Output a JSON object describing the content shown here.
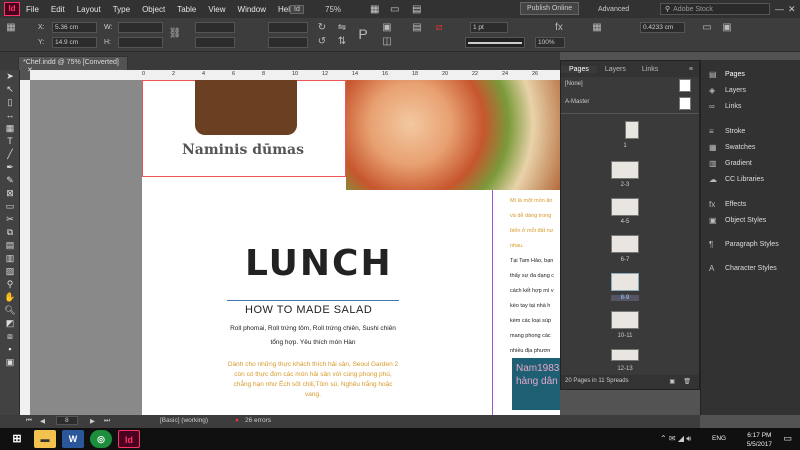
{
  "menu": {
    "logo": "Id",
    "items": [
      "File",
      "Edit",
      "Layout",
      "Type",
      "Object",
      "Table",
      "View",
      "Window",
      "Help"
    ],
    "zoom": "75%",
    "publish": "Publish Online",
    "workspace": "Advanced",
    "search_placeholder": "Adobe Stock"
  },
  "control": {
    "x_label": "X:",
    "x_val": "5.36 cm",
    "y_label": "Y:",
    "y_val": "14.9 cm",
    "w_label": "W:",
    "h_label": "H:",
    "stroke": "1 pt",
    "pct": "100%",
    "offset": "0.4233 cm"
  },
  "document": {
    "tab": "*Chef.indd @ 75% [Converted]"
  },
  "ruler_ticks": [
    "0",
    "2",
    "4",
    "6",
    "8",
    "10",
    "12",
    "14",
    "16",
    "18",
    "20",
    "22",
    "24",
    "26",
    "28",
    "30"
  ],
  "page": {
    "brand": "Naminis dūmas",
    "heading": "LUNCH",
    "subtitle": "HOW TO MADE SALAD",
    "body1": "Roll phomai, Roll trứng tôm, Roll trứng chiên, Sushi chiên tổng hợp. Yêu thích món Hàn",
    "body2": "Dành cho những thực khách thích hải sản, Seoul Garden 2 còn có thực đơn các món hải sản với cùng phong phú, chẳng hạn như Ếch sốt chili,Tôm sú, Nghêu trắng hoặc vang.",
    "column_lines": [
      "Mì là một món ăn",
      "và dễ dàng trong",
      "biến ở mỗi đất nư",
      "nhau.",
      "Tại Tam Hảo, bạn",
      "thấy sự đa dạng c",
      "cách kết hợp mì v",
      "kèo tay tại nhà h",
      "kèm các loại súp",
      "mang phong các",
      "nhiều địa phươn"
    ],
    "blue_text": "Nam1983 hàng dân"
  },
  "pages_panel": {
    "tabs": [
      "Pages",
      "Layers",
      "Links"
    ],
    "masters": [
      "[None]",
      "A-Master"
    ],
    "spreads": [
      "1",
      "2-3",
      "4-5",
      "6-7",
      "8-9",
      "10-11",
      "12-13"
    ],
    "footer": "20 Pages in 11 Spreads"
  },
  "dock": [
    {
      "icon": "▤",
      "label": "Pages"
    },
    {
      "icon": "◈",
      "label": "Layers"
    },
    {
      "icon": "∞",
      "label": "Links"
    },
    {
      "icon": "≡",
      "label": "Stroke"
    },
    {
      "icon": "▦",
      "label": "Swatches"
    },
    {
      "icon": "▥",
      "label": "Gradient"
    },
    {
      "icon": "☁",
      "label": "CC Libraries"
    },
    {
      "icon": "fx",
      "label": "Effects"
    },
    {
      "icon": "▣",
      "label": "Object Styles"
    },
    {
      "icon": "¶",
      "label": "Paragraph Styles"
    },
    {
      "icon": "A",
      "label": "Character Styles"
    }
  ],
  "status": {
    "page": "8",
    "style": "[Basic] (working)",
    "errors": "26 errors"
  },
  "taskbar": {
    "lang": "ENG",
    "time": "6:17 PM",
    "date": "5/5/2017"
  }
}
